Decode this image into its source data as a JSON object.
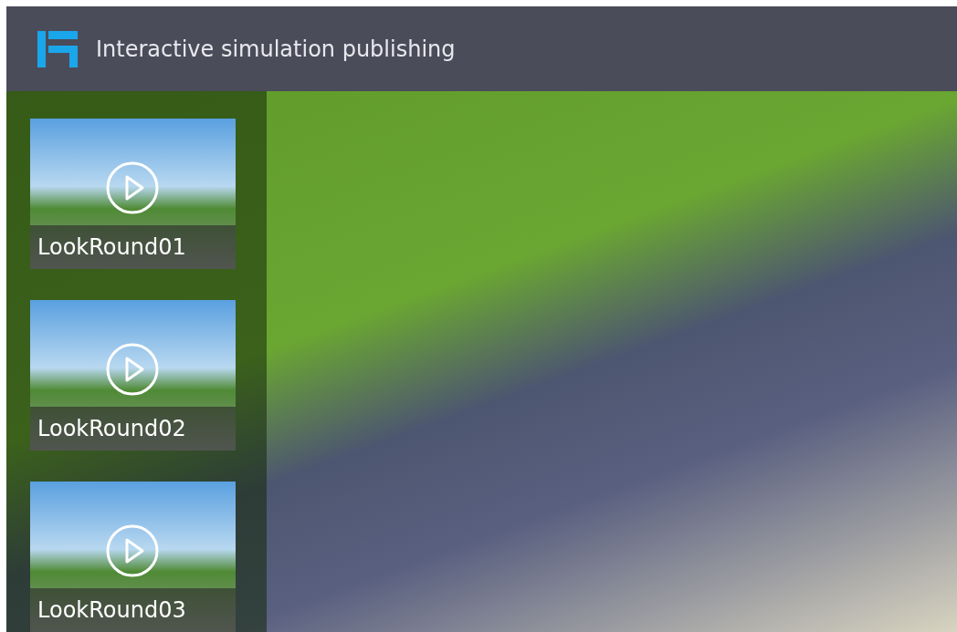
{
  "header": {
    "title": "Interactive simulation publishing"
  },
  "videos": [
    {
      "label": "LookRound01"
    },
    {
      "label": "LookRound02"
    },
    {
      "label": "LookRound03"
    }
  ]
}
